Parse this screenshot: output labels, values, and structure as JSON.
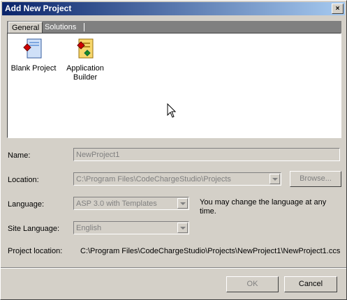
{
  "window": {
    "title": "Add New Project",
    "close_glyph": "×"
  },
  "tabs": [
    {
      "label": "General"
    },
    {
      "label": "Solutions"
    }
  ],
  "templates": [
    {
      "label": "Blank Project"
    },
    {
      "label": "Application Builder"
    }
  ],
  "form": {
    "name_label": "Name:",
    "name_value": "NewProject1",
    "location_label": "Location:",
    "location_value": "C:\\Program Files\\CodeChargeStudio\\Projects",
    "browse_label": "Browse...",
    "language_label": "Language:",
    "language_value": "ASP 3.0 with Templates",
    "language_note": "You may change the language at any time.",
    "site_language_label": "Site Language:",
    "site_language_value": "English",
    "project_location_label": "Project location:",
    "project_location_value": "C:\\Program Files\\CodeChargeStudio\\Projects\\NewProject1\\NewProject1.ccs"
  },
  "buttons": {
    "ok_label": "OK",
    "cancel_label": "Cancel"
  },
  "colors": {
    "title_start": "#0a246a",
    "title_end": "#a6caf0",
    "face": "#d4d0c8"
  }
}
